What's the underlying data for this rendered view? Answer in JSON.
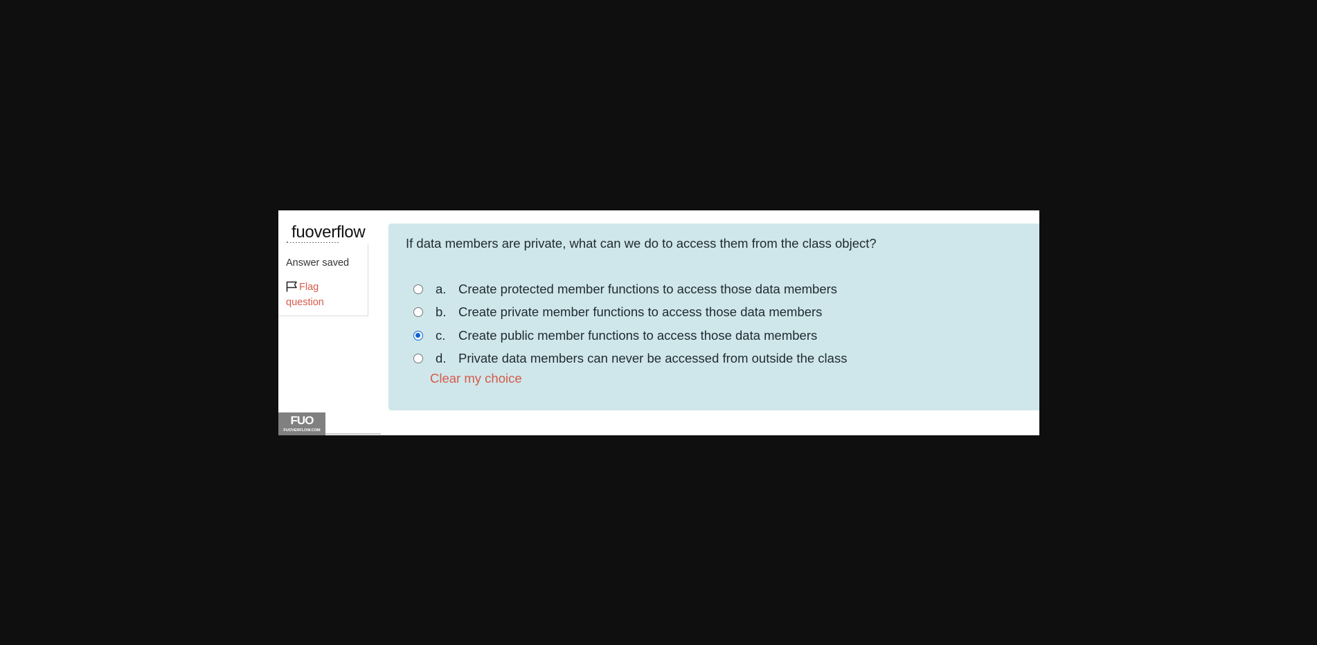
{
  "watermark": {
    "site": "fuoverflow"
  },
  "info": {
    "status": "Answer saved",
    "flag_label": "Flag question"
  },
  "question": {
    "text": "If data members are private, what can we do to access them from the class object?",
    "options": [
      {
        "letter": "a.",
        "text": "Create protected member functions to access those data members",
        "selected": false
      },
      {
        "letter": "b.",
        "text": "Create private member functions to access those data members",
        "selected": false
      },
      {
        "letter": "c.",
        "text": "Create public member functions to access those data members",
        "selected": true
      },
      {
        "letter": "d.",
        "text": "Private data members can never be accessed from outside the class",
        "selected": false
      }
    ],
    "clear_label": "Clear my choice"
  },
  "logo": {
    "mark": "FUO",
    "caption": "FUOVERFLOW.COM"
  },
  "colors": {
    "panel": "#cfe7ea",
    "link": "#d65a4a",
    "radio_selected": "#0b62d6",
    "background": "#0f0f10"
  }
}
